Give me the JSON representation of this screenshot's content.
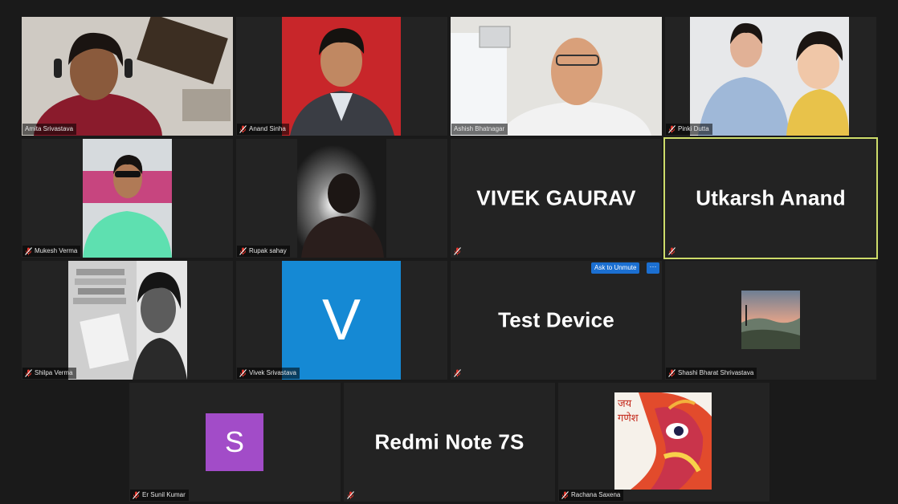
{
  "participants": [
    {
      "name": "Amita Srivastava",
      "muted": false
    },
    {
      "name": "Anand Sinha",
      "muted": true
    },
    {
      "name": "Ashish Bhatnagar",
      "muted": false
    },
    {
      "name": "Pinki Dutta",
      "muted": true
    },
    {
      "name": "Mukesh Verma",
      "muted": true
    },
    {
      "name": "Rupak sahay",
      "muted": true
    },
    {
      "name": "VIVEK GAURAV",
      "muted": true
    },
    {
      "name": "Utkarsh Anand",
      "muted": true
    },
    {
      "name": "Shilpa Verma",
      "muted": true
    },
    {
      "name": "Vivek Srivastava",
      "muted": true
    },
    {
      "name": "Test Device",
      "muted": true
    },
    {
      "name": "Shashi Bharat Shrivastava",
      "muted": true
    },
    {
      "name": "Er Sunil Kumar",
      "muted": true
    },
    {
      "name": "Redmi Note 7S",
      "muted": true
    },
    {
      "name": "Rachana Saxena",
      "muted": true
    }
  ],
  "avatars": {
    "vivek_letter": "V",
    "sunil_letter": "S"
  },
  "controls": {
    "ask_to_unmute": "Ask to Unmute",
    "more": "···"
  },
  "ganesha_text": {
    "line1": "जय",
    "line2": "गणेश"
  },
  "colors": {
    "active_speaker_border": "#cddc6a",
    "vivek_avatar_bg": "#1589d4",
    "sunil_avatar_bg": "#a24cc8",
    "unmute_button_bg": "#1b6fd1",
    "mute_icon": "#e0352b"
  }
}
